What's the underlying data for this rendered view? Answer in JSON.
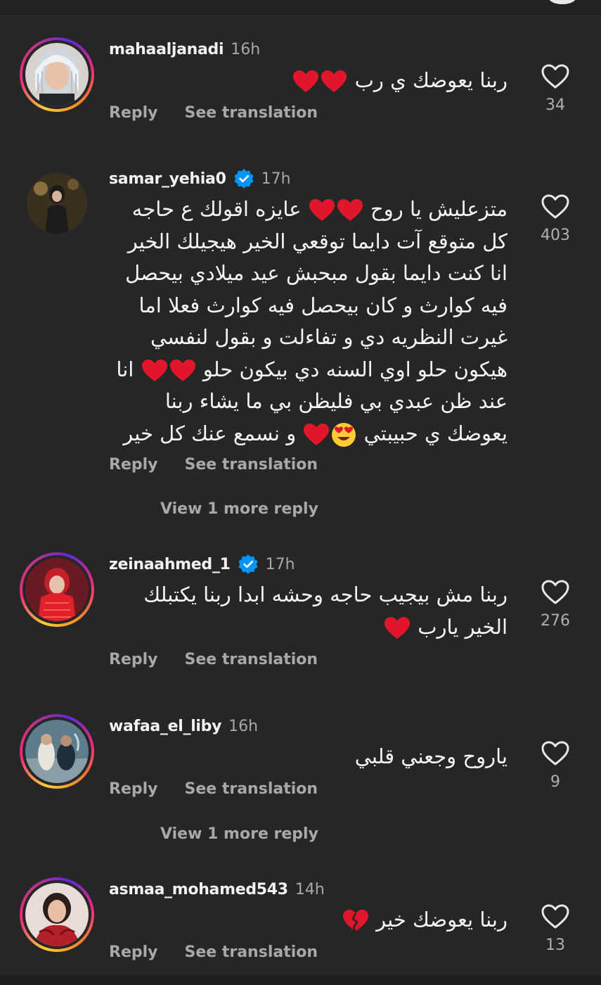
{
  "colors": {
    "background": "#262626",
    "secondary_text": "#a8a8a8",
    "heart_red": "#e0162b",
    "verified_blue": "#0095f6"
  },
  "labels": {
    "reply": "Reply",
    "see_translation": "See translation"
  },
  "comments": [
    {
      "username": "mahaaljanadi",
      "time": "16h",
      "verified": false,
      "text_lines": [
        "ربنا يعوضك ي رب"
      ],
      "likes": "34"
    },
    {
      "username": "samar_yehia0",
      "time": "17h",
      "verified": true,
      "text_lines": [
        "متزعليش يا روح",
        "عايزه اقولك ع حاجه",
        "كل متوقع آت دايما توقعي الخير هيجيلك الخير",
        "انا كنت دايما بقول مبحبش عيد ميلادي بيحصل",
        "فيه كوارث و كان بيحصل فيه كوارث فعلا اما",
        "غيرت النظريه دي و تفاءلت و بقول لنفسي",
        "هيكون حلو اوي السنه دي بيكون حلو",
        "انا",
        "عند ظن عبدي بي فليظن بي ما يشاء ربنا",
        "يعوضك ي حبيبتي",
        "و نسمع عنك كل خير"
      ],
      "likes": "403",
      "view_more": "View 1 more reply"
    },
    {
      "username": "zeinaahmed_1",
      "time": "17h",
      "verified": true,
      "text_lines": [
        "ربنا مش بيجيب حاجه وحشه ابدا ربنا يكتبلك",
        "الخير يارب"
      ],
      "likes": "276"
    },
    {
      "username": "wafaa_el_liby",
      "time": "16h",
      "verified": false,
      "text_lines": [
        "ياروح وجعني قلبي"
      ],
      "likes": "9",
      "view_more": "View 1 more reply"
    },
    {
      "username": "asmaa_mohamed543",
      "time": "14h",
      "verified": false,
      "text_lines": [
        "ربنا يعوضك خير"
      ],
      "likes": "13"
    }
  ]
}
